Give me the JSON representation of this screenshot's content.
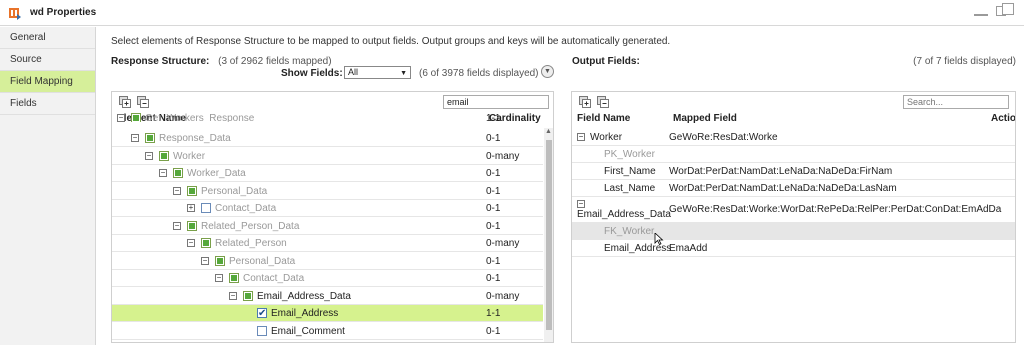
{
  "window": {
    "title": "wd Properties",
    "icon": "transformation-icon"
  },
  "sidebar": {
    "items": [
      {
        "label": "General",
        "active": false
      },
      {
        "label": "Source",
        "active": false
      },
      {
        "label": "Field Mapping",
        "active": true
      },
      {
        "label": "Fields",
        "active": false
      }
    ]
  },
  "instructions": "Select elements of Response Structure to be mapped to output fields. Output groups and keys will be automatically generated.",
  "response": {
    "label": "Response Structure:",
    "count": "(3 of 2962 fields mapped)",
    "show_fields_label": "Show Fields:",
    "show_fields_value": "All",
    "displayed": "(6 of 3978 fields displayed)",
    "search_value": "email",
    "col_element": "Element Name",
    "col_cardinality": "Cardinality",
    "rows": [
      {
        "label": "Get_Workers_Response",
        "card": "1-1",
        "toggle": "−",
        "box": "filled",
        "dim": true,
        "level": 0,
        "partial": true
      },
      {
        "label": "Response_Data",
        "card": "0-1",
        "toggle": "−",
        "box": "filled",
        "dim": true,
        "level": 1
      },
      {
        "label": "Worker",
        "card": "0-many",
        "toggle": "−",
        "box": "filled",
        "dim": true,
        "level": 2
      },
      {
        "label": "Worker_Data",
        "card": "0-1",
        "toggle": "−",
        "box": "filled",
        "dim": true,
        "level": 3
      },
      {
        "label": "Personal_Data",
        "card": "0-1",
        "toggle": "−",
        "box": "filled",
        "dim": true,
        "level": 4
      },
      {
        "label": "Contact_Data",
        "card": "0-1",
        "toggle": "+",
        "box": "empty",
        "dim": true,
        "level": 5
      },
      {
        "label": "Related_Person_Data",
        "card": "0-1",
        "toggle": "−",
        "box": "filled",
        "dim": true,
        "level": 4
      },
      {
        "label": "Related_Person",
        "card": "0-many",
        "toggle": "−",
        "box": "filled",
        "dim": true,
        "level": 5
      },
      {
        "label": "Personal_Data",
        "card": "0-1",
        "toggle": "−",
        "box": "filled",
        "dim": true,
        "level": 6
      },
      {
        "label": "Contact_Data",
        "card": "0-1",
        "toggle": "−",
        "box": "filled",
        "dim": true,
        "level": 7
      },
      {
        "label": "Email_Address_Data",
        "card": "0-many",
        "toggle": "−",
        "box": "filled",
        "dim": false,
        "level": 8
      },
      {
        "label": "Email_Address",
        "card": "1-1",
        "toggle": "",
        "box": "checked",
        "dim": false,
        "level": 9,
        "selected": true
      },
      {
        "label": "Email_Comment",
        "card": "0-1",
        "toggle": "",
        "box": "empty",
        "dim": false,
        "level": 9
      }
    ]
  },
  "output": {
    "label": "Output Fields:",
    "displayed": "(7 of 7 fields displayed)",
    "search_placeholder": "Search...",
    "col_field": "Field Name",
    "col_mapped": "Mapped Field",
    "col_action": "Actio",
    "rows": [
      {
        "field": "Worker",
        "mapped": "GeWoRe:ResDat:Worke",
        "group": true
      },
      {
        "field": "PK_Worker",
        "mapped": "",
        "dim": true
      },
      {
        "field": "First_Name",
        "mapped": "WorDat:PerDat:NamDat:LeNaDa:NaDeDa:FirNam"
      },
      {
        "field": "Last_Name",
        "mapped": "WorDat:PerDat:NamDat:LeNaDa:NaDeDa:LasNam"
      },
      {
        "field": "Email_Address_Data",
        "mapped": "GeWoRe:ResDat:Worke:WorDat:RePeDa:RelPer:PerDat:ConDat:EmAdDa",
        "group": true,
        "tall": true
      },
      {
        "field": "FK_Worker",
        "mapped": "",
        "dim": true,
        "hover": true
      },
      {
        "field": "Email_Address",
        "mapped": "EmaAdd"
      }
    ]
  }
}
